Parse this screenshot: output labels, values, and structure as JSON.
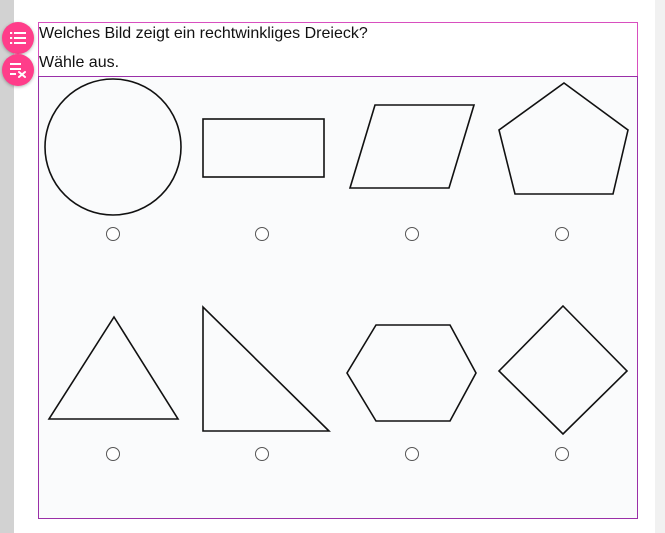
{
  "question": {
    "line1": "Welches Bild zeigt ein rechtwinkliges Dreieck?",
    "line2": "Wähle aus."
  },
  "toolbar": {
    "list_icon": "list-icon",
    "clear_list_icon": "clear-list-icon",
    "accent_color": "#ff3d8a"
  },
  "options": [
    {
      "shape": "circle",
      "selected": false
    },
    {
      "shape": "rectangle",
      "selected": false
    },
    {
      "shape": "parallelogram",
      "selected": false
    },
    {
      "shape": "pentagon",
      "selected": false
    },
    {
      "shape": "equilateral-triangle",
      "selected": false
    },
    {
      "shape": "right-triangle",
      "selected": false
    },
    {
      "shape": "hexagon",
      "selected": false
    },
    {
      "shape": "diamond",
      "selected": false
    }
  ]
}
